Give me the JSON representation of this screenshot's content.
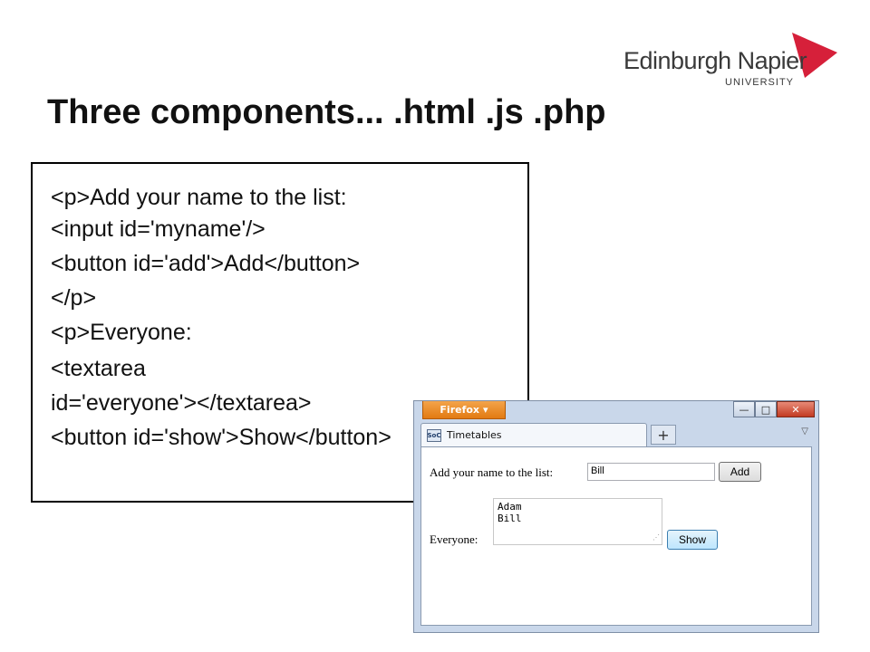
{
  "logo": {
    "name": "Edinburgh Napier",
    "sub": "UNIVERSITY",
    "accent": "#d6203a"
  },
  "slide": {
    "title": "Three components... .html .js .php"
  },
  "code": {
    "lines": [
      "<p>Add your name to the list:",
      "  <input id='myname'/>",
      "  <button id='add'>Add</button>",
      "</p>",
      "<p>Everyone:",
      " <textarea",
      "id='everyone'></textarea>",
      " <button id='show'>Show</button>"
    ]
  },
  "browser": {
    "app_button": "Firefox",
    "tab_title": "Timetables",
    "favicon_text": "SoC",
    "new_tab": "+",
    "controls": {
      "minimize": "—",
      "maximize": "□",
      "close": "✕"
    },
    "form": {
      "name_label": "Add your name to the list:",
      "name_value": "Bill",
      "add_label": "Add",
      "everyone_label": "Everyone:",
      "everyone_lines": [
        "Adam",
        "Bill"
      ],
      "show_label": "Show"
    }
  }
}
